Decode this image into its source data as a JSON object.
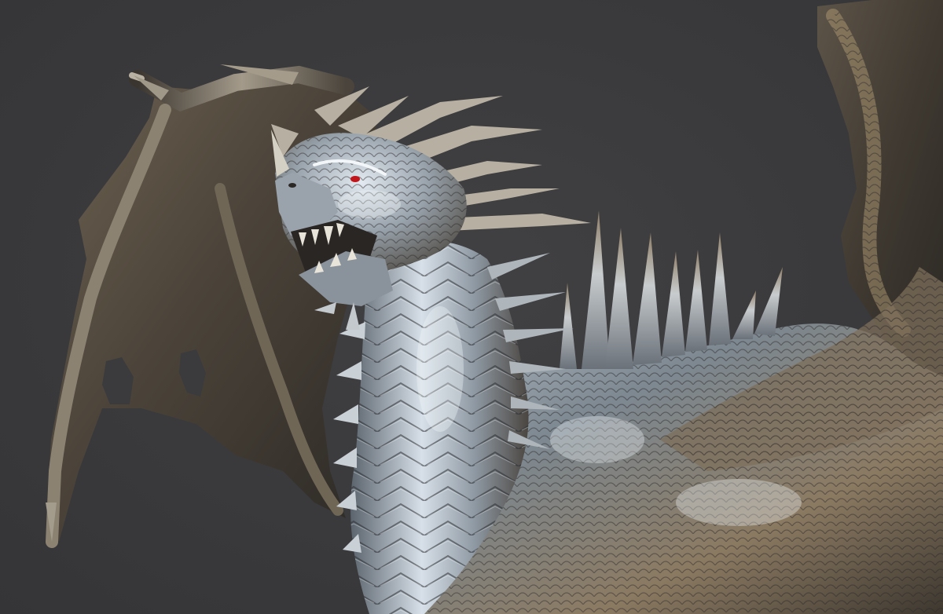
{
  "scene": {
    "subject": "dragon-sculpt",
    "background_color": "#3b3b3d",
    "material": {
      "highlight": "#dfe8f1",
      "midtone": "#8f9aa5",
      "bronze": "#8a7354",
      "shadow": "#1f1d1b"
    },
    "eye_color": "#c0161c"
  }
}
